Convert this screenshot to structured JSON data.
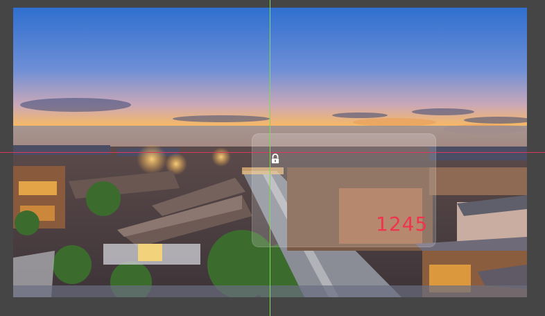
{
  "overlay": {
    "label": "1245",
    "label_color": "#f0344e"
  },
  "guides": {
    "vertical_color": "#7ed957",
    "horizontal_color": "#d9395c"
  },
  "icons": {
    "lock": "lock-icon"
  },
  "colors": {
    "workspace_background": "#454545"
  }
}
